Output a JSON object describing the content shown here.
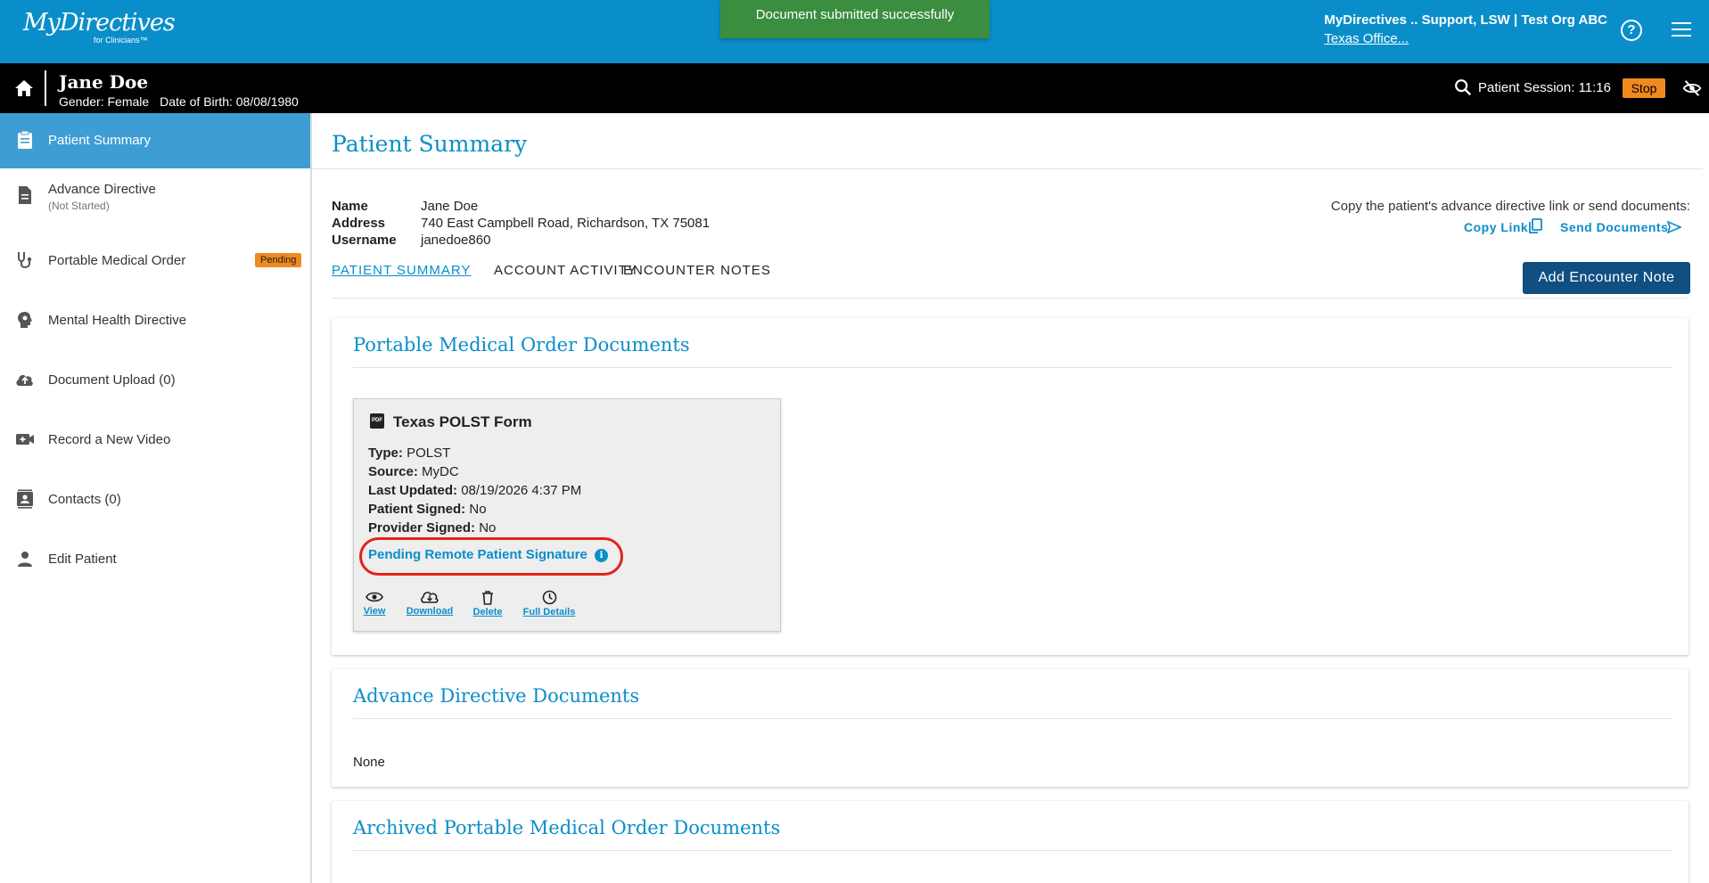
{
  "header": {
    "logo_text": "MyDirectives",
    "logo_sub": "for Clinicians™",
    "toast": "Document submitted successfully",
    "user_name": "MyDirectives .. Support, LSW | Test Org ABC",
    "user_org": "Texas Office...",
    "help_icon": "help-circle-icon",
    "menu_icon": "hamburger-menu-icon"
  },
  "patient_bar": {
    "name": "Jane Doe",
    "gender": "Gender: Female",
    "dob": "Date of Birth: 08/08/1980",
    "session": "Patient Session: 11:16",
    "stop": "Stop"
  },
  "sidebar": {
    "items": [
      {
        "label": "Patient Summary",
        "icon": "clipboard-icon",
        "active": true
      },
      {
        "label": "Advance Directive",
        "sub": "(Not Started)",
        "icon": "document-icon"
      },
      {
        "label": "Portable Medical Order",
        "badge": "Pending",
        "icon": "stethoscope-icon"
      },
      {
        "label": "Mental Health Directive",
        "icon": "head-gear-icon"
      },
      {
        "label": "Document Upload (0)",
        "icon": "cloud-upload-icon"
      },
      {
        "label": "Record a New Video",
        "icon": "video-add-icon"
      },
      {
        "label": "Contacts (0)",
        "icon": "contacts-icon"
      },
      {
        "label": "Edit Patient",
        "icon": "person-icon"
      }
    ]
  },
  "main": {
    "title": "Patient Summary",
    "info": {
      "name_label": "Name",
      "name_value": "Jane Doe",
      "address_label": "Address",
      "address_value": "740 East Campbell Road, Richardson, TX 75081",
      "username_label": "Username",
      "username_value": "janedoe860"
    },
    "copy_text": "Copy the patient's advance directive link or send documents:",
    "copy_link": "Copy Link",
    "send_documents": "Send Documents",
    "tabs": [
      "PATIENT SUMMARY",
      "ACCOUNT ACTIVITY",
      "ENCOUNTER NOTES"
    ],
    "add_note": "Add Encounter Note",
    "pmo_panel": {
      "title": "Portable Medical Order Documents",
      "card": {
        "title": "Texas POLST Form",
        "fields": [
          {
            "k": "Type:",
            "v": "POLST"
          },
          {
            "k": "Source:",
            "v": "MyDC"
          },
          {
            "k": "Last Updated:",
            "v": "08/19/2026 4:37 PM"
          },
          {
            "k": "Patient Signed:",
            "v": "No"
          },
          {
            "k": "Provider Signed:",
            "v": "No"
          }
        ],
        "pending": "Pending Remote Patient Signature",
        "actions": [
          "View",
          "Download",
          "Delete",
          "Full Details"
        ]
      }
    },
    "ad_panel": {
      "title": "Advance Directive Documents",
      "empty": "None"
    },
    "archived_panel": {
      "title": "Archived Portable Medical Order Documents"
    }
  },
  "colors": {
    "brand": "#0a8ec9",
    "dark_button": "#0f4f82",
    "badge": "#f0891e",
    "toast": "#3b8d3f",
    "highlight": "#e2231a"
  }
}
